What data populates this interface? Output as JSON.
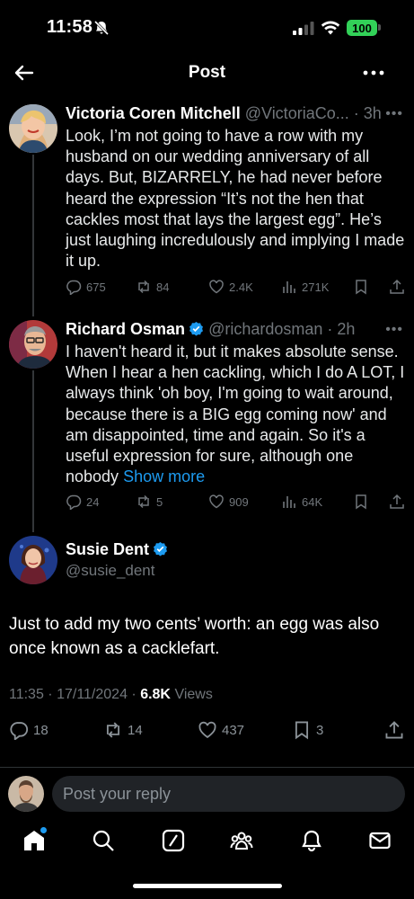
{
  "status_bar": {
    "time": "11:58",
    "battery": "100"
  },
  "header": {
    "title": "Post"
  },
  "thread": [
    {
      "author": "Victoria Coren Mitchell",
      "handle": "@VictoriaCo...",
      "time": "· 3h",
      "text": "Look, I’m not going to have a row with my husband on our wedding anniversary of all days. But, BIZARRELY, he had never before heard the expression “It’s not the hen that cackles most that lays the largest egg”. He’s just laughing incredulously and implying I made it up.",
      "replies": "675",
      "reposts": "84",
      "likes": "2.4K",
      "views": "271K"
    },
    {
      "author": "Richard Osman",
      "handle": "@richardosman",
      "time": "· 2h",
      "text": "I haven't heard it, but it makes absolute sense. When I hear a hen cackling, which I do A LOT, I always think 'oh boy, I'm going to wait around, because there is a BIG egg coming now' and am disappointed, time and again. So it's a useful expression for sure, although one nobody",
      "show_more": "Show more",
      "replies": "24",
      "reposts": "5",
      "likes": "909",
      "views": "64K"
    }
  ],
  "main_post": {
    "author": "Susie Dent",
    "handle": "@susie_dent",
    "text": "Just to add my two cents’ worth: an egg was also once known as a cacklefart.",
    "timestamp": "11:35 · 17/11/2024 ·",
    "views_count": "6.8K",
    "views_label": "Views",
    "replies": "18",
    "reposts": "14",
    "likes": "437",
    "bookmarks": "3"
  },
  "reply_bar": {
    "placeholder": "Post your reply"
  },
  "colors": {
    "accent": "#1d9bf0",
    "background": "#000000",
    "secondary_text": "#71767b"
  },
  "icons": [
    "back-arrow-icon",
    "more-icon",
    "reply-icon",
    "repost-icon",
    "like-icon",
    "views-icon",
    "bookmark-icon",
    "share-icon",
    "verified-icon",
    "home-icon",
    "search-icon",
    "grok-icon",
    "communities-icon",
    "notifications-icon",
    "messages-icon"
  ]
}
